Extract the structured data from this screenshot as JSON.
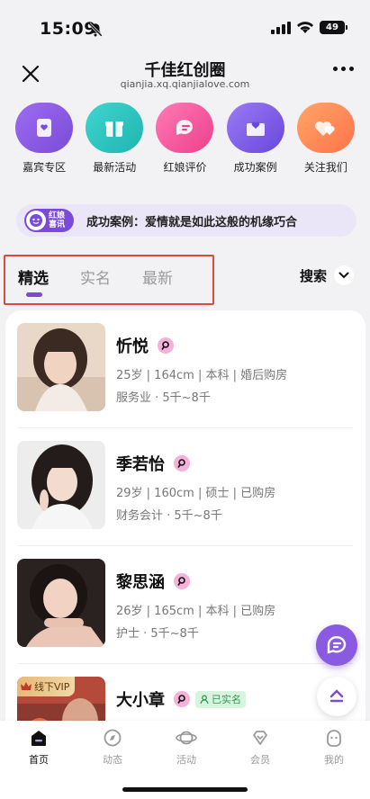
{
  "status_bar": {
    "time": "15:09",
    "battery": "49"
  },
  "header": {
    "title": "千佳红创圈",
    "url": "qianjia.xq.qianjialove.com"
  },
  "quick_actions": [
    {
      "label": "嘉宾专区",
      "icon": "card-icon",
      "color": "#8a5be0"
    },
    {
      "label": "最新活动",
      "icon": "gift-icon",
      "color": "#2cc4be"
    },
    {
      "label": "红娘评价",
      "icon": "chat-icon",
      "color": "#f0559c"
    },
    {
      "label": "成功案例",
      "icon": "envelope-heart-icon",
      "color": "#7d5ae6"
    },
    {
      "label": "关注我们",
      "icon": "heart-icon",
      "color": "#ff8a5a"
    }
  ],
  "notice": {
    "badge": "红娘喜讯",
    "text": "成功案例：爱情就是如此这般的机缘巧合"
  },
  "tabs": [
    {
      "label": "精选",
      "active": true
    },
    {
      "label": "实名",
      "active": false
    },
    {
      "label": "最新",
      "active": false
    }
  ],
  "search": {
    "label": "搜索"
  },
  "profiles": [
    {
      "name": "忻悦",
      "line1": "25岁 | 164cm | 本科 | 婚后购房",
      "line2": "服务业 · 5千~8千"
    },
    {
      "name": "季若怡",
      "line1": "29岁 | 160cm | 硕士 | 已购房",
      "line2": "财务会计 · 5千~8千"
    },
    {
      "name": "黎思涵",
      "line1": "26岁 | 165cm | 本科 | 已购房",
      "line2": "护士 · 5千~8千"
    },
    {
      "name": "大小章",
      "vip_tag": "线下VIP",
      "verified": "已实名"
    }
  ],
  "bottom_nav": [
    {
      "label": "首页",
      "icon": "home-icon",
      "active": true
    },
    {
      "label": "动态",
      "icon": "compass-icon",
      "active": false
    },
    {
      "label": "活动",
      "icon": "planet-icon",
      "active": false
    },
    {
      "label": "会员",
      "icon": "diamond-icon",
      "active": false
    },
    {
      "label": "我的",
      "icon": "profile-icon",
      "active": false
    }
  ],
  "colors": {
    "accent": "#7a4bd8",
    "background": "#f2f2f4",
    "highlight_box": "#e04a3c"
  }
}
